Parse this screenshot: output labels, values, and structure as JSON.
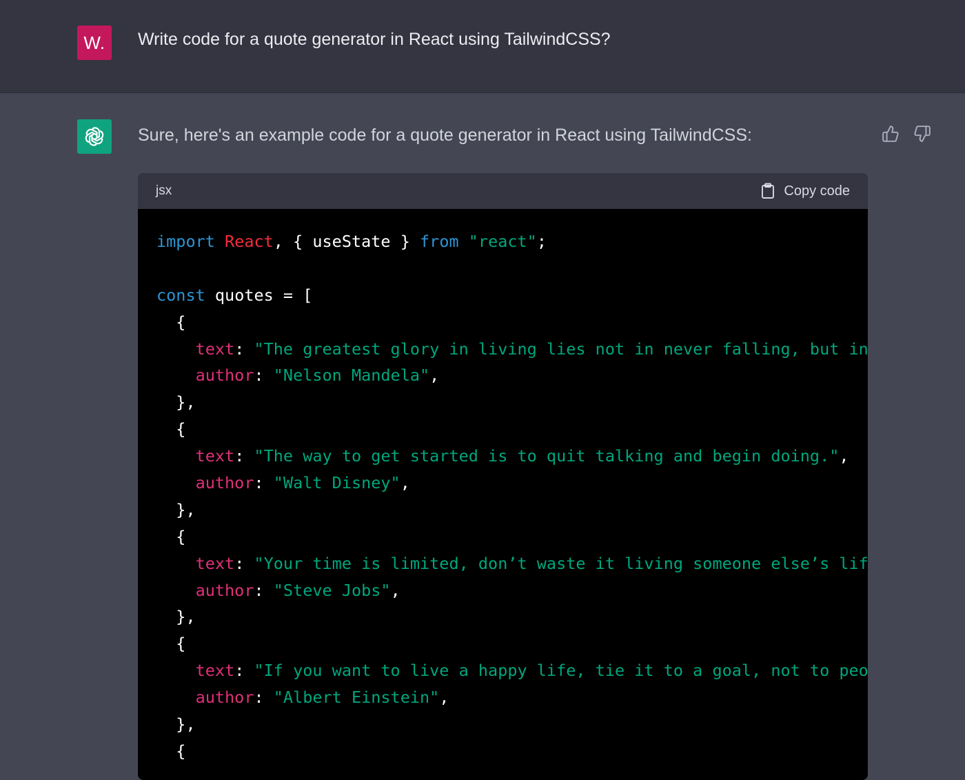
{
  "colors": {
    "user_bg": "#343541",
    "assistant_bg": "#444654",
    "user_avatar": "#c3185c",
    "gpt_avatar": "#10a37f",
    "code_bg": "#000000",
    "keyword": "#2e95d3",
    "class_name": "#f22c3d",
    "property": "#df3079",
    "string": "#00a67d"
  },
  "user": {
    "avatar_initial": "W.",
    "message": "Write code for a quote generator in React using TailwindCSS?"
  },
  "assistant": {
    "avatar_icon": "openai-logo-icon",
    "message": "Sure, here's an example code for a quote generator in React using TailwindCSS:",
    "feedback": {
      "up_icon": "thumbs-up-icon",
      "down_icon": "thumbs-down-icon"
    }
  },
  "code_block": {
    "language": "jsx",
    "copy_label": "Copy code",
    "copy_icon": "clipboard-icon",
    "lines": [
      [
        {
          "t": "kw",
          "v": "import"
        },
        {
          "t": "plain",
          "v": " "
        },
        {
          "t": "cls",
          "v": "React"
        },
        {
          "t": "plain",
          "v": ", { useState } "
        },
        {
          "t": "kw",
          "v": "from"
        },
        {
          "t": "plain",
          "v": " "
        },
        {
          "t": "str",
          "v": "\"react\""
        },
        {
          "t": "plain",
          "v": ";"
        }
      ],
      [],
      [
        {
          "t": "kw",
          "v": "const"
        },
        {
          "t": "plain",
          "v": " quotes = ["
        }
      ],
      [
        {
          "t": "plain",
          "v": "  {"
        }
      ],
      [
        {
          "t": "plain",
          "v": "    "
        },
        {
          "t": "prop",
          "v": "text"
        },
        {
          "t": "plain",
          "v": ": "
        },
        {
          "t": "str",
          "v": "\"The greatest glory in living lies not in never falling, but in ri"
        }
      ],
      [
        {
          "t": "plain",
          "v": "    "
        },
        {
          "t": "prop",
          "v": "author"
        },
        {
          "t": "plain",
          "v": ": "
        },
        {
          "t": "str",
          "v": "\"Nelson Mandela\""
        },
        {
          "t": "plain",
          "v": ","
        }
      ],
      [
        {
          "t": "plain",
          "v": "  },"
        }
      ],
      [
        {
          "t": "plain",
          "v": "  {"
        }
      ],
      [
        {
          "t": "plain",
          "v": "    "
        },
        {
          "t": "prop",
          "v": "text"
        },
        {
          "t": "plain",
          "v": ": "
        },
        {
          "t": "str",
          "v": "\"The way to get started is to quit talking and begin doing.\""
        },
        {
          "t": "plain",
          "v": ","
        }
      ],
      [
        {
          "t": "plain",
          "v": "    "
        },
        {
          "t": "prop",
          "v": "author"
        },
        {
          "t": "plain",
          "v": ": "
        },
        {
          "t": "str",
          "v": "\"Walt Disney\""
        },
        {
          "t": "plain",
          "v": ","
        }
      ],
      [
        {
          "t": "plain",
          "v": "  },"
        }
      ],
      [
        {
          "t": "plain",
          "v": "  {"
        }
      ],
      [
        {
          "t": "plain",
          "v": "    "
        },
        {
          "t": "prop",
          "v": "text"
        },
        {
          "t": "plain",
          "v": ": "
        },
        {
          "t": "str",
          "v": "\"Your time is limited, don’t waste it living someone else’s life.\""
        }
      ],
      [
        {
          "t": "plain",
          "v": "    "
        },
        {
          "t": "prop",
          "v": "author"
        },
        {
          "t": "plain",
          "v": ": "
        },
        {
          "t": "str",
          "v": "\"Steve Jobs\""
        },
        {
          "t": "plain",
          "v": ","
        }
      ],
      [
        {
          "t": "plain",
          "v": "  },"
        }
      ],
      [
        {
          "t": "plain",
          "v": "  {"
        }
      ],
      [
        {
          "t": "plain",
          "v": "    "
        },
        {
          "t": "prop",
          "v": "text"
        },
        {
          "t": "plain",
          "v": ": "
        },
        {
          "t": "str",
          "v": "\"If you want to live a happy life, tie it to a goal, not to people"
        }
      ],
      [
        {
          "t": "plain",
          "v": "    "
        },
        {
          "t": "prop",
          "v": "author"
        },
        {
          "t": "plain",
          "v": ": "
        },
        {
          "t": "str",
          "v": "\"Albert Einstein\""
        },
        {
          "t": "plain",
          "v": ","
        }
      ],
      [
        {
          "t": "plain",
          "v": "  },"
        }
      ],
      [
        {
          "t": "plain",
          "v": "  {"
        }
      ]
    ]
  }
}
